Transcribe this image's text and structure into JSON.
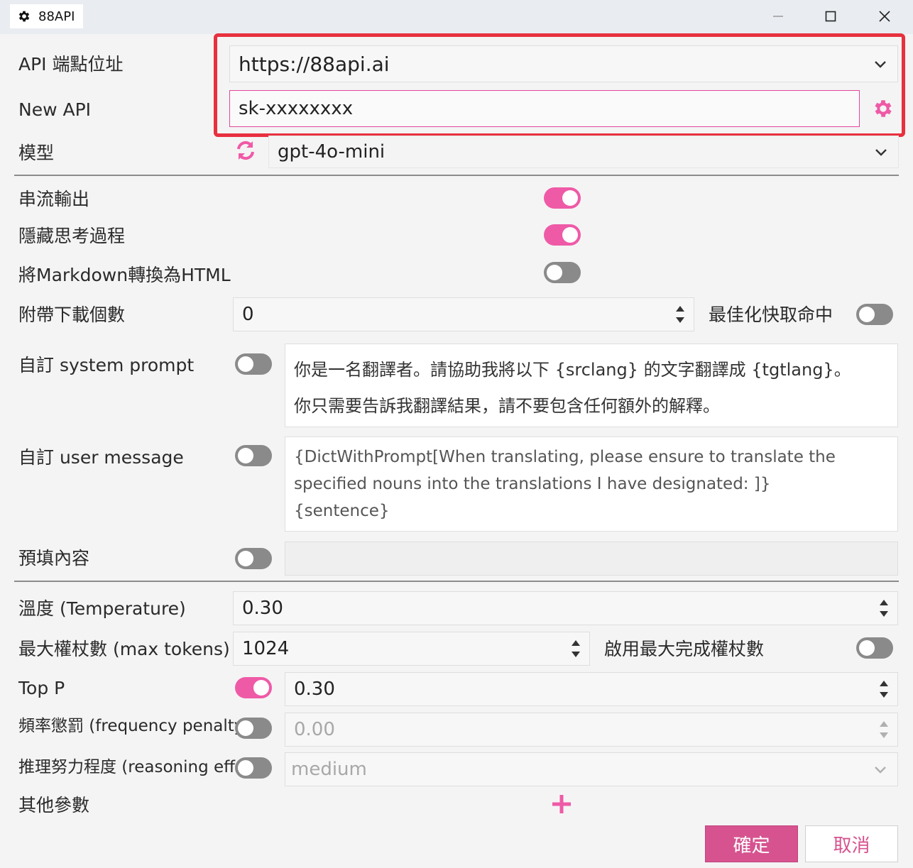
{
  "window": {
    "title": "88API",
    "controls": [
      "minimize-icon",
      "maximize-icon",
      "close-icon"
    ]
  },
  "form": {
    "endpoint": {
      "label": "API 端點位址",
      "value": "https://88api.ai"
    },
    "api_key": {
      "label": "New API",
      "value": "sk-xxxxxxxx"
    },
    "model": {
      "label": "模型",
      "value": "gpt-4o-mini"
    },
    "streaming": {
      "label": "串流輸出",
      "enabled": true
    },
    "hide_thinking": {
      "label": "隱藏思考過程",
      "enabled": true
    },
    "markdown_to_html": {
      "label": "將Markdown轉換為HTML",
      "enabled": false
    },
    "downloads": {
      "label": "附帶下載個數",
      "value": "0"
    },
    "cache_hit": {
      "label": "最佳化快取命中",
      "enabled": false
    },
    "system_prompt": {
      "label": "自訂 system prompt",
      "enabled": false,
      "line1": "你是一名翻譯者。請協助我將以下 {srclang} 的文字翻譯成 {tgtlang}。",
      "line2": "你只需要告訴我翻譯結果，請不要包含任何額外的解釋。"
    },
    "user_message": {
      "label": "自訂 user message",
      "enabled": false,
      "line1": "{DictWithPrompt[When translating, please ensure to translate the",
      "line2": "specified nouns into the translations I have designated: ]}",
      "line3": "{sentence}"
    },
    "prefill": {
      "label": "預填內容",
      "enabled": false,
      "value": ""
    },
    "temperature": {
      "label": "溫度 (Temperature)",
      "value": "0.30"
    },
    "max_tokens": {
      "label": "最大權杖數 (max tokens)",
      "value": "1024"
    },
    "max_completion_tokens": {
      "label": "啟用最大完成權杖數",
      "enabled": false
    },
    "top_p": {
      "label": "Top P",
      "enabled": true,
      "value": "0.30"
    },
    "frequency_penalty": {
      "label": "頻率懲罰 (frequency penalty)",
      "enabled": false,
      "value": "0.00"
    },
    "reasoning_effort": {
      "label": "推理努力程度 (reasoning effort)",
      "enabled": false,
      "value": "medium"
    },
    "other_params": {
      "label": "其他參數"
    }
  },
  "buttons": {
    "ok": "確定",
    "cancel": "取消"
  },
  "colors": {
    "accent": "#ef5aa7",
    "button": "#d6538f",
    "highlight": "#e8303f"
  }
}
